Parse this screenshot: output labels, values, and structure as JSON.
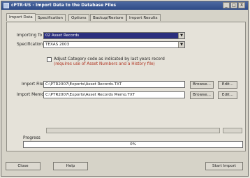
{
  "window": {
    "title": "cPTR-US - Import Data to the Database Files",
    "controls": [
      "_",
      "□",
      "X"
    ]
  },
  "tabs": [
    {
      "label": "Import Data",
      "active": true
    },
    {
      "label": "Specification",
      "active": false
    },
    {
      "label": "Options",
      "active": false
    },
    {
      "label": "Backup/Restore",
      "active": false
    },
    {
      "label": "Import Results",
      "active": false
    }
  ],
  "form": {
    "importing_to": {
      "label": "Importing To",
      "value": "02 Asset Records"
    },
    "specification": {
      "label": "Specification",
      "value": "TEXAS 2003"
    },
    "adjust_checkbox": {
      "checked": false,
      "label": "Adjust Category code as indicated by last years record",
      "note": "(requires use of Asset Numbers and a History file)"
    },
    "import_file": {
      "label": "Import File",
      "value": "C:\\PTR2007\\Exports\\Asset Records.TXT"
    },
    "import_memo": {
      "label": "Import Memo",
      "value": "C:\\PTR2007\\Exports\\Asset Records Memo.TXT"
    },
    "browse_label": "Browse...",
    "edit_label": "Edit..."
  },
  "progress": {
    "label": "Progress",
    "percent_text": "0%",
    "percent": 0
  },
  "buttons": {
    "close": "Close",
    "help": "Help",
    "start_import": "Start Import"
  },
  "colors": {
    "titlebar": "#2e4a86",
    "selection": "#2b2f7e",
    "note": "#b0321f"
  },
  "icons": {
    "window": "app-icon",
    "dropdown": "chevron-down-icon"
  }
}
